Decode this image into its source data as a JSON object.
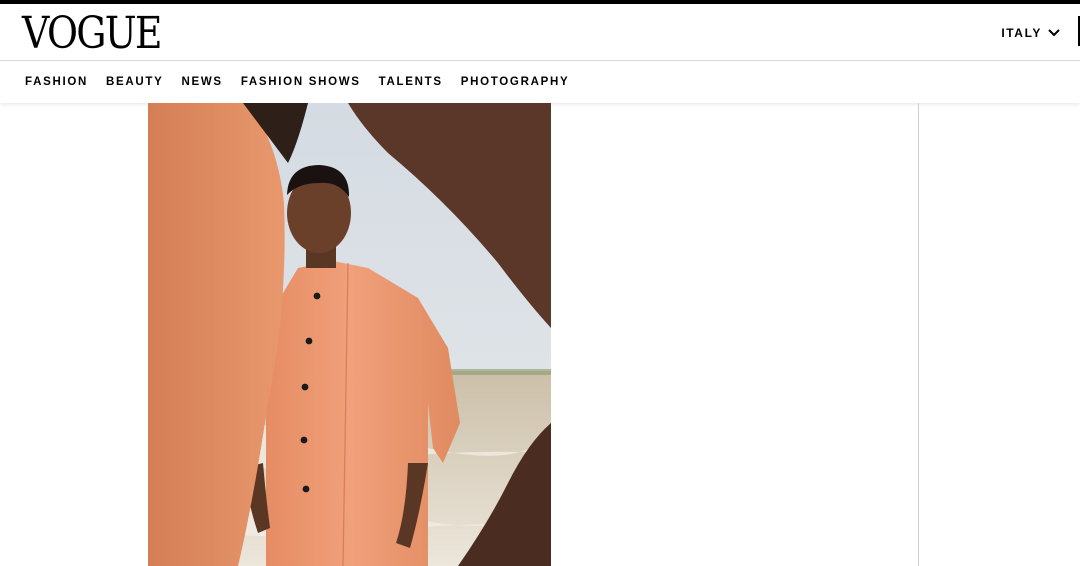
{
  "header": {
    "logo": "VOGUE",
    "edition": "ITALY"
  },
  "nav": {
    "items": [
      "FASHION",
      "BEAUTY",
      "NEWS",
      "FASHION SHOWS",
      "TALENTS",
      "PHOTOGRAPHY"
    ]
  },
  "icons": {
    "edition_dropdown": "chevron-down-icon"
  },
  "colors": {
    "accent": "#000000",
    "garment": "#e8946a",
    "sky": "#c9d3dc"
  }
}
